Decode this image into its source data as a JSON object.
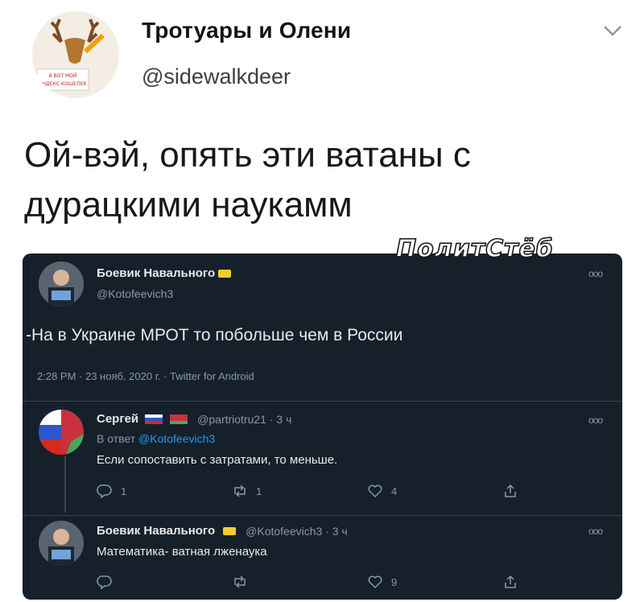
{
  "outer": {
    "name": "Тротуары и Олени",
    "handle": "@sidewalkdeer",
    "avatar_sign": "А ВОТ МОЙ ЯНДЕКС КОШЕЛЕК",
    "text": "Ой-вэй, опять эти ватаны с дурацкими наукамм"
  },
  "watermark": "ПолитСтёб",
  "main_tweet": {
    "name": "Боевик Навального",
    "handle": "@Kotofeevich3",
    "text": "-На в Украине МРОТ то побольше чем в России",
    "meta": "2:28 PM · 23 нояб. 2020 г. · Twitter for Android"
  },
  "reply1": {
    "name": "Сергей",
    "handle_time": "@partriotru21 · 3 ч",
    "reply_prefix": "В ответ",
    "reply_to": "@Kotofeevich3",
    "text": "Если сопоставить с затратами, то меньше.",
    "actions": {
      "reply": "1",
      "retweet": "1",
      "like": "4"
    }
  },
  "reply2": {
    "name": "Боевик Навального",
    "handle_time": "@Kotofeevich3 · 3 ч",
    "text": "Математика- ватная лженаука",
    "actions": {
      "reply": "",
      "retweet": "",
      "like": "9"
    }
  },
  "icons": {
    "chevron": "chevron-down-icon",
    "more": "more-dots-icon",
    "reply": "reply-icon",
    "retweet": "retweet-icon",
    "like": "heart-icon",
    "share": "share-icon"
  },
  "colors": {
    "dark_bg": "#15202b",
    "link_blue": "#1d9bf0",
    "grey_text": "#8899a6"
  }
}
